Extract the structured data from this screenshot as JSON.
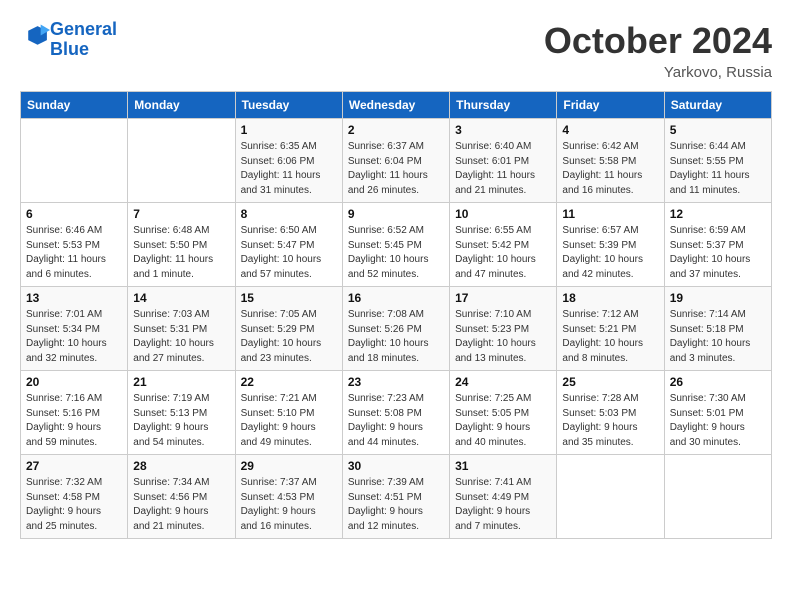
{
  "header": {
    "logo_line1": "General",
    "logo_line2": "Blue",
    "month": "October 2024",
    "location": "Yarkovo, Russia"
  },
  "weekdays": [
    "Sunday",
    "Monday",
    "Tuesday",
    "Wednesday",
    "Thursday",
    "Friday",
    "Saturday"
  ],
  "weeks": [
    [
      {
        "day": "",
        "info": ""
      },
      {
        "day": "",
        "info": ""
      },
      {
        "day": "1",
        "info": "Sunrise: 6:35 AM\nSunset: 6:06 PM\nDaylight: 11 hours\nand 31 minutes."
      },
      {
        "day": "2",
        "info": "Sunrise: 6:37 AM\nSunset: 6:04 PM\nDaylight: 11 hours\nand 26 minutes."
      },
      {
        "day": "3",
        "info": "Sunrise: 6:40 AM\nSunset: 6:01 PM\nDaylight: 11 hours\nand 21 minutes."
      },
      {
        "day": "4",
        "info": "Sunrise: 6:42 AM\nSunset: 5:58 PM\nDaylight: 11 hours\nand 16 minutes."
      },
      {
        "day": "5",
        "info": "Sunrise: 6:44 AM\nSunset: 5:55 PM\nDaylight: 11 hours\nand 11 minutes."
      }
    ],
    [
      {
        "day": "6",
        "info": "Sunrise: 6:46 AM\nSunset: 5:53 PM\nDaylight: 11 hours\nand 6 minutes."
      },
      {
        "day": "7",
        "info": "Sunrise: 6:48 AM\nSunset: 5:50 PM\nDaylight: 11 hours\nand 1 minute."
      },
      {
        "day": "8",
        "info": "Sunrise: 6:50 AM\nSunset: 5:47 PM\nDaylight: 10 hours\nand 57 minutes."
      },
      {
        "day": "9",
        "info": "Sunrise: 6:52 AM\nSunset: 5:45 PM\nDaylight: 10 hours\nand 52 minutes."
      },
      {
        "day": "10",
        "info": "Sunrise: 6:55 AM\nSunset: 5:42 PM\nDaylight: 10 hours\nand 47 minutes."
      },
      {
        "day": "11",
        "info": "Sunrise: 6:57 AM\nSunset: 5:39 PM\nDaylight: 10 hours\nand 42 minutes."
      },
      {
        "day": "12",
        "info": "Sunrise: 6:59 AM\nSunset: 5:37 PM\nDaylight: 10 hours\nand 37 minutes."
      }
    ],
    [
      {
        "day": "13",
        "info": "Sunrise: 7:01 AM\nSunset: 5:34 PM\nDaylight: 10 hours\nand 32 minutes."
      },
      {
        "day": "14",
        "info": "Sunrise: 7:03 AM\nSunset: 5:31 PM\nDaylight: 10 hours\nand 27 minutes."
      },
      {
        "day": "15",
        "info": "Sunrise: 7:05 AM\nSunset: 5:29 PM\nDaylight: 10 hours\nand 23 minutes."
      },
      {
        "day": "16",
        "info": "Sunrise: 7:08 AM\nSunset: 5:26 PM\nDaylight: 10 hours\nand 18 minutes."
      },
      {
        "day": "17",
        "info": "Sunrise: 7:10 AM\nSunset: 5:23 PM\nDaylight: 10 hours\nand 13 minutes."
      },
      {
        "day": "18",
        "info": "Sunrise: 7:12 AM\nSunset: 5:21 PM\nDaylight: 10 hours\nand 8 minutes."
      },
      {
        "day": "19",
        "info": "Sunrise: 7:14 AM\nSunset: 5:18 PM\nDaylight: 10 hours\nand 3 minutes."
      }
    ],
    [
      {
        "day": "20",
        "info": "Sunrise: 7:16 AM\nSunset: 5:16 PM\nDaylight: 9 hours\nand 59 minutes."
      },
      {
        "day": "21",
        "info": "Sunrise: 7:19 AM\nSunset: 5:13 PM\nDaylight: 9 hours\nand 54 minutes."
      },
      {
        "day": "22",
        "info": "Sunrise: 7:21 AM\nSunset: 5:10 PM\nDaylight: 9 hours\nand 49 minutes."
      },
      {
        "day": "23",
        "info": "Sunrise: 7:23 AM\nSunset: 5:08 PM\nDaylight: 9 hours\nand 44 minutes."
      },
      {
        "day": "24",
        "info": "Sunrise: 7:25 AM\nSunset: 5:05 PM\nDaylight: 9 hours\nand 40 minutes."
      },
      {
        "day": "25",
        "info": "Sunrise: 7:28 AM\nSunset: 5:03 PM\nDaylight: 9 hours\nand 35 minutes."
      },
      {
        "day": "26",
        "info": "Sunrise: 7:30 AM\nSunset: 5:01 PM\nDaylight: 9 hours\nand 30 minutes."
      }
    ],
    [
      {
        "day": "27",
        "info": "Sunrise: 7:32 AM\nSunset: 4:58 PM\nDaylight: 9 hours\nand 25 minutes."
      },
      {
        "day": "28",
        "info": "Sunrise: 7:34 AM\nSunset: 4:56 PM\nDaylight: 9 hours\nand 21 minutes."
      },
      {
        "day": "29",
        "info": "Sunrise: 7:37 AM\nSunset: 4:53 PM\nDaylight: 9 hours\nand 16 minutes."
      },
      {
        "day": "30",
        "info": "Sunrise: 7:39 AM\nSunset: 4:51 PM\nDaylight: 9 hours\nand 12 minutes."
      },
      {
        "day": "31",
        "info": "Sunrise: 7:41 AM\nSunset: 4:49 PM\nDaylight: 9 hours\nand 7 minutes."
      },
      {
        "day": "",
        "info": ""
      },
      {
        "day": "",
        "info": ""
      }
    ]
  ]
}
